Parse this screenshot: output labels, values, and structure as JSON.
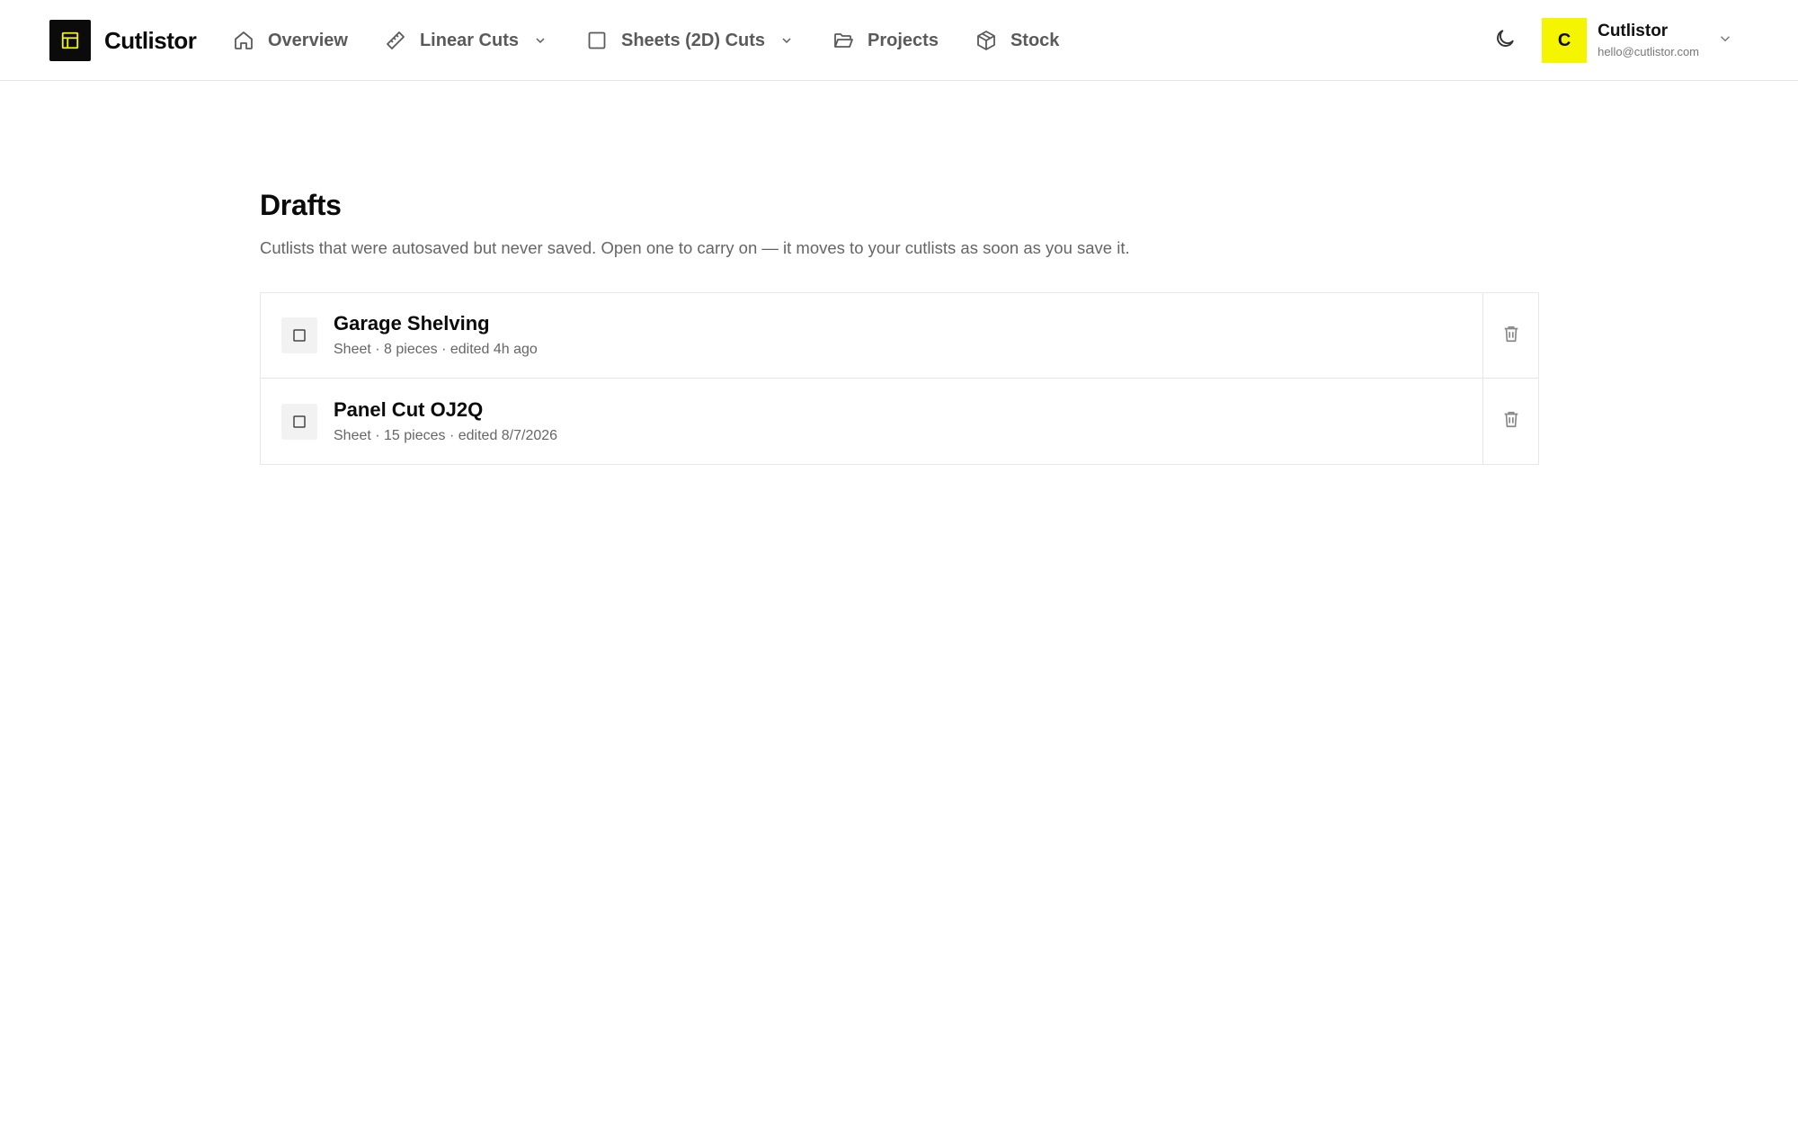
{
  "app": {
    "brand_name": "Cutlistor",
    "logo_icon": "layout-panel-icon",
    "accent_color": "#f5f500",
    "logo_bg": "#0b0b0b"
  },
  "nav": {
    "items": [
      {
        "label": "Overview",
        "icon": "home-icon",
        "has_dropdown": false
      },
      {
        "label": "Linear Cuts",
        "icon": "ruler-icon",
        "has_dropdown": true
      },
      {
        "label": "Sheets (2D) Cuts",
        "icon": "square-icon",
        "has_dropdown": true
      },
      {
        "label": "Projects",
        "icon": "folder-open-icon",
        "has_dropdown": false
      },
      {
        "label": "Stock",
        "icon": "package-icon",
        "has_dropdown": false
      }
    ]
  },
  "user": {
    "avatar_initial": "C",
    "name": "Cutlistor",
    "email": "hello@cutlistor.com",
    "theme_icon": "moon-icon"
  },
  "page": {
    "title": "Drafts",
    "description": "Cutlists that were autosaved but never saved. Open one to carry on — it moves to your cutlists as soon as you save it."
  },
  "drafts": [
    {
      "name": "Garage Shelving",
      "meta": "Sheet · 8 pieces · edited 4h ago",
      "icon": "square-icon"
    },
    {
      "name": "Panel Cut OJ2Q",
      "meta": "Sheet · 15 pieces · edited 8/7/2026",
      "icon": "square-icon"
    }
  ]
}
